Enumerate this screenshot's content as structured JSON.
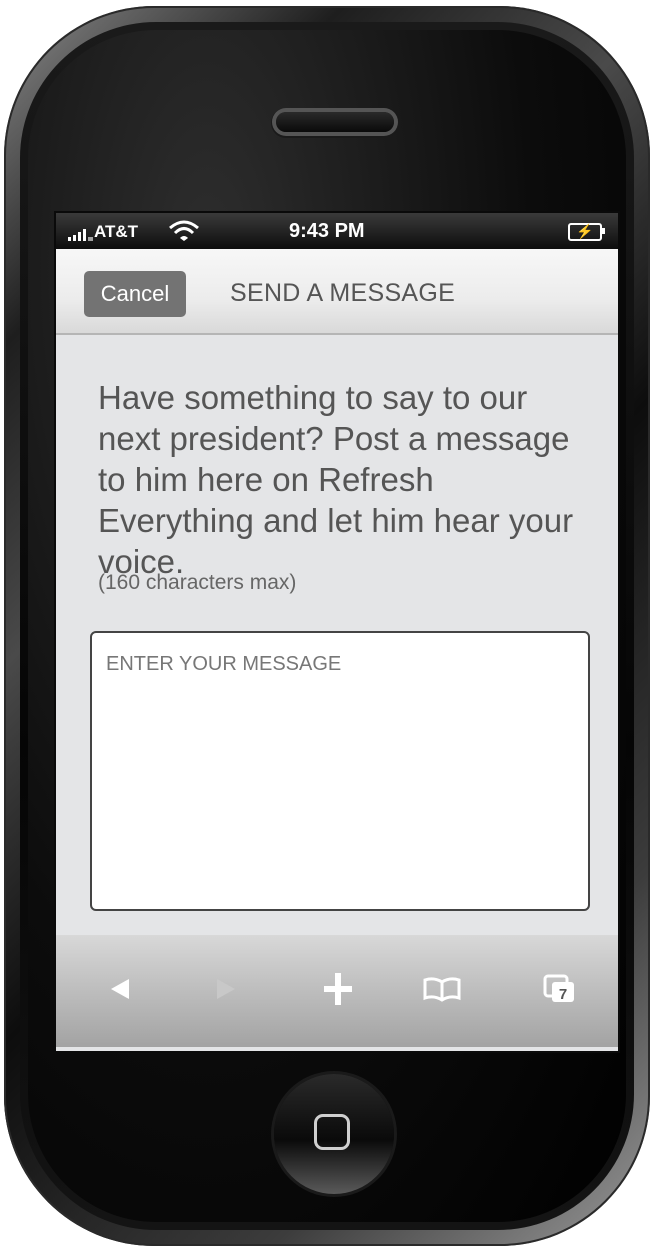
{
  "status_bar": {
    "carrier": "AT&T",
    "time": "9:43 PM",
    "signal_icon": "signal-bars-icon",
    "wifi_icon": "wifi-icon",
    "battery_icon": "battery-charging-icon"
  },
  "nav": {
    "cancel_label": "Cancel",
    "title": "SEND A MESSAGE"
  },
  "content": {
    "intro": "Have something to say to our next president? Post a message to him here on Refresh Everything and let him hear your voice.",
    "char_limit_note": "(160 characters max)",
    "message_placeholder": "ENTER YOUR MESSAGE",
    "message_value": ""
  },
  "toolbar": {
    "back_icon": "back-arrow-icon",
    "forward_icon": "forward-arrow-icon",
    "add_icon": "plus-icon",
    "bookmarks_icon": "bookmarks-book-icon",
    "pages_icon": "pages-icon",
    "pages_count": "7"
  },
  "colors": {
    "screen_background": "#e4e5e7",
    "cancel_button": "#737373",
    "text": "#555555"
  }
}
